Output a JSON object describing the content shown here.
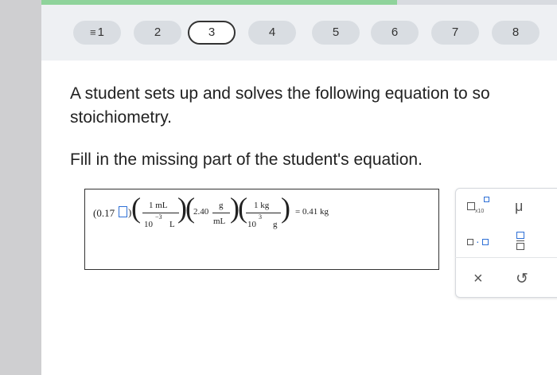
{
  "nav": {
    "progress_fraction": 0.69,
    "questions": [
      {
        "label": "1",
        "icon": "menu-icon"
      },
      {
        "label": "2"
      },
      {
        "label": "3",
        "active": true
      },
      {
        "label": "4"
      },
      {
        "label": "5"
      },
      {
        "label": "6"
      },
      {
        "label": "7"
      },
      {
        "label": "8"
      }
    ]
  },
  "prompt": {
    "line1": "A student sets up and solves the following equation to so",
    "line2": "stoichiometry.",
    "instruction": "Fill in the missing part of the student's equation."
  },
  "equation": {
    "first_factor": "(0.17",
    "frac1_num": "1 mL",
    "frac1_den_base": "10",
    "frac1_den_exp": "−3",
    "frac1_den_unit": "L",
    "mult2_value": "2.40",
    "frac2_num": "g",
    "frac2_den": "mL",
    "frac3_num": "1 kg",
    "frac3_den_base": "10",
    "frac3_den_exp": "3",
    "frac3_den_unit": "g",
    "result": "= 0.41 kg"
  },
  "toolbox": {
    "sci_notation_label": "x10",
    "mu_symbol": "μ",
    "dot_symbol": "·",
    "clear_symbol": "×",
    "undo_symbol": "↺"
  },
  "colors": {
    "progress": "#8fd39b",
    "slot_border": "#2d6fd6",
    "gutter": "#cfcfd1",
    "topbar": "#eef0f3"
  }
}
